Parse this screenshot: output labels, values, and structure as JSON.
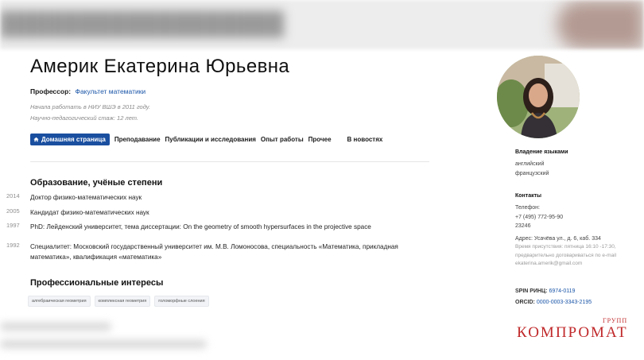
{
  "profile": {
    "name": "Америк Екатерина Юрьевна",
    "position_label": "Профессор:",
    "position_link": "Факультет математики",
    "since_line1": "Начала работать в НИУ ВШЭ в 2011 году.",
    "since_line2": "Научно-педагогический стаж: 12 лет."
  },
  "tabs": [
    {
      "label": "Домашняя страница",
      "icon": "home-icon"
    },
    {
      "label": "Преподавание"
    },
    {
      "label": "Публикации и исследования"
    },
    {
      "label": "Опыт работы"
    },
    {
      "label": "Прочее"
    },
    {
      "label": "В новостях"
    }
  ],
  "education": {
    "heading": "Образование, учёные степени",
    "items": [
      {
        "year": "2014",
        "text": "Доктор физико-математических наук"
      },
      {
        "year": "2005",
        "text": "Кандидат физико-математических наук"
      },
      {
        "year": "1997",
        "text": "PhD: Лейденский университет, тема диссертации: On the geometry of smooth hypersurfaces in the projective space"
      },
      {
        "year": "1992",
        "text": "Специалитет: Московский государственный университет им. М.В. Ломоносова, специальность «Математика, прикладная математика», квалификация «математика»"
      }
    ]
  },
  "interests": {
    "heading": "Профессиональные интересы",
    "tags": [
      "алгебраическая геометрия",
      "комплексная геометрия",
      "голоморфные слоения"
    ]
  },
  "sidebar": {
    "languages_heading": "Владение языками",
    "languages": [
      "английский",
      "французский"
    ],
    "contacts_heading": "Контакты",
    "phone_label": "Телефон:",
    "phone": "+7 (495) 772-95-90",
    "ext": "23246",
    "address": "Адрес: Усачёва ул., д. 6, каб. 334",
    "hours_line1": "Время присутствия: пятница 16:10 -17:30,",
    "hours_line2": "предварительно договариваться по e-mail",
    "email": "ekaterina.amerik@gmail.com",
    "spin_label": "SPIN РИНЦ:",
    "spin_value": "6974-0119",
    "orcid_label": "ORCID:",
    "orcid_value": "0000-0003-3343-2195"
  },
  "watermark": {
    "main": "КОМПРОМАТ",
    "sub": "ГРУПП"
  },
  "colors": {
    "accent": "#1a4fa0",
    "link": "#1a55a8",
    "watermark": "#c0282a"
  }
}
